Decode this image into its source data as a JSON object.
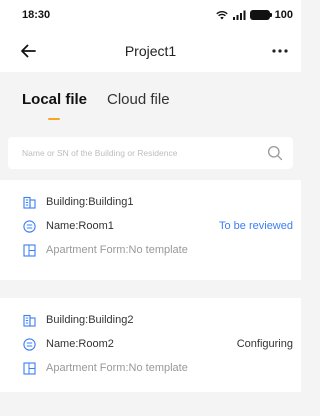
{
  "status_bar": {
    "time": "18:30",
    "battery": "100"
  },
  "nav": {
    "title": "Project1"
  },
  "tabs": [
    {
      "label": "Local file",
      "active": true
    },
    {
      "label": "Cloud file",
      "active": false
    }
  ],
  "search": {
    "placeholder": "Name or SN of the Building or Residence",
    "value": ""
  },
  "records": [
    {
      "building": "Building:Building1",
      "name": "Name:Room1",
      "status": "To be reviewed",
      "apartment_form": "Apartment Form:No template"
    },
    {
      "building": "Building:Building2",
      "name": "Name:Room2",
      "status": "Configuring",
      "apartment_form": "Apartment Form:No template"
    }
  ],
  "colors": {
    "accent": "#f5a623",
    "icon_blue": "#3b7ff5",
    "status_review": "#3b7ff5",
    "background": "#f4f4f4"
  }
}
